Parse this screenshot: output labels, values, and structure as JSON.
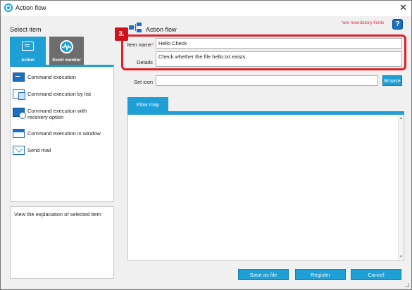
{
  "window": {
    "title": "Action flow",
    "close_glyph": "✕"
  },
  "left_panel": {
    "header": "Select item",
    "tabs": [
      {
        "label": "Action",
        "icon": "command-window-icon",
        "selected": true
      },
      {
        "label": "Event monitor",
        "icon": "monitor-pulse-icon",
        "selected": false
      }
    ],
    "items": [
      {
        "label": "Command execution",
        "icon": "terminal-icon"
      },
      {
        "label": "Command execution by list",
        "icon": "list-command-icon"
      },
      {
        "label": "Command execution with recovery option",
        "icon": "recovery-command-icon"
      },
      {
        "label": "Command execution in window",
        "icon": "window-command-icon"
      },
      {
        "label": "Send mail",
        "icon": "mail-icon"
      }
    ],
    "explanation": "View the explanation of selected item"
  },
  "header": {
    "title": "Action flow",
    "mandatory_note": "*are mandatory fields",
    "help_glyph": "?"
  },
  "callout": {
    "step": "3."
  },
  "form": {
    "item_name": {
      "label": "Item name",
      "required_mark": "*",
      "value": "Hello Check"
    },
    "details": {
      "label": "Details",
      "value": "Check whether the file hello.txt exists."
    },
    "set_icon": {
      "label": "Set icon",
      "value": "",
      "browse_label": "Browse"
    }
  },
  "flow_map": {
    "tab_label": "Flow map"
  },
  "footer": {
    "save_label": "Save as file",
    "register_label": "Register",
    "cancel_label": "Cancel"
  },
  "colors": {
    "accent": "#1e9fd6",
    "dark_blue": "#1e6fc0",
    "callout_red": "#e21f26",
    "mandatory_red": "#e0364a"
  }
}
